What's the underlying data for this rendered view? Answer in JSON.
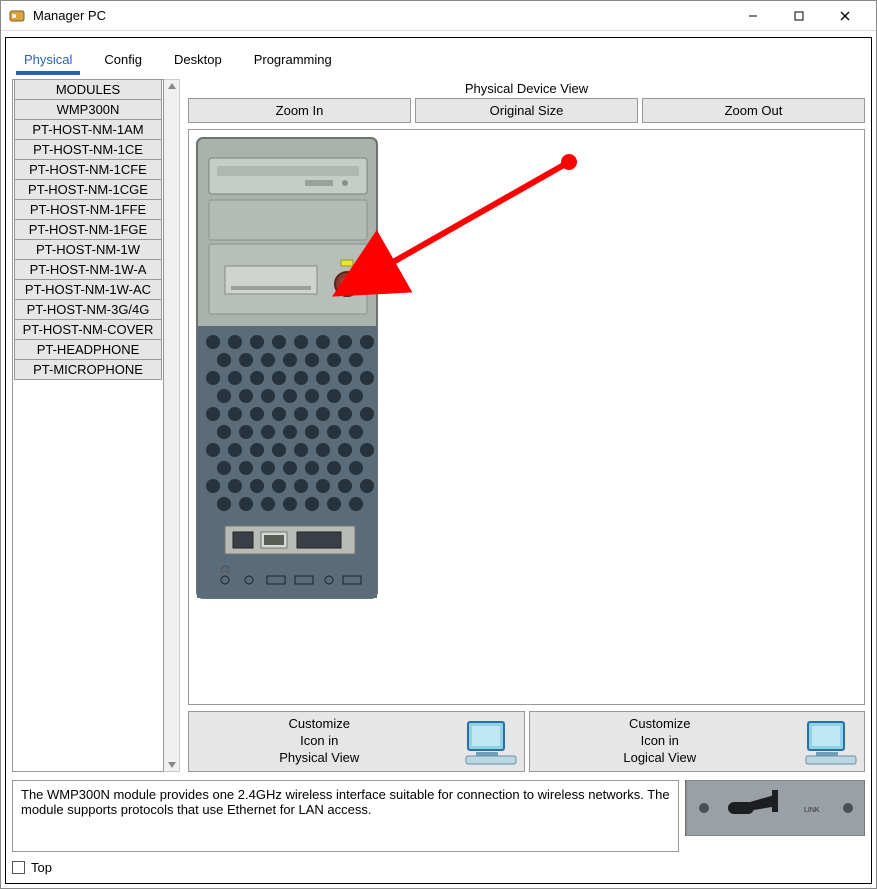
{
  "window": {
    "title": "Manager PC"
  },
  "tabs": [
    "Physical",
    "Config",
    "Desktop",
    "Programming"
  ],
  "active_tab": 0,
  "modules": {
    "header": "MODULES",
    "items": [
      "WMP300N",
      "PT-HOST-NM-1AM",
      "PT-HOST-NM-1CE",
      "PT-HOST-NM-1CFE",
      "PT-HOST-NM-1CGE",
      "PT-HOST-NM-1FFE",
      "PT-HOST-NM-1FGE",
      "PT-HOST-NM-1W",
      "PT-HOST-NM-1W-A",
      "PT-HOST-NM-1W-AC",
      "PT-HOST-NM-3G/4G",
      "PT-HOST-NM-COVER",
      "PT-HEADPHONE",
      "PT-MICROPHONE"
    ]
  },
  "view": {
    "label": "Physical Device View",
    "zoom_in": "Zoom In",
    "original": "Original Size",
    "zoom_out": "Zoom Out"
  },
  "customize": {
    "physical": "Customize\nIcon in\nPhysical View",
    "logical": "Customize\nIcon in\nLogical View"
  },
  "description": "The WMP300N module provides one 2.4GHz wireless interface suitable for connection to wireless networks. The module supports protocols that use Ethernet for LAN access.",
  "footer": {
    "top_label": "Top"
  }
}
